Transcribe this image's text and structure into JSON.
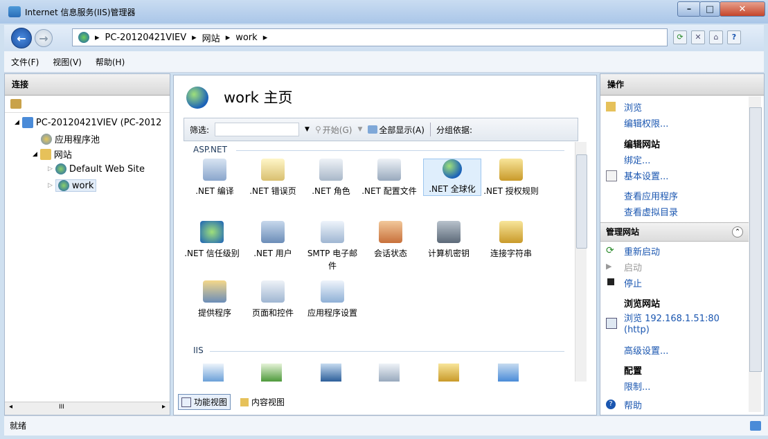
{
  "window": {
    "title": "Internet 信息服务(IIS)管理器"
  },
  "address": {
    "crumbs": [
      "PC-20120421VIEV",
      "网站",
      "work"
    ]
  },
  "menu": {
    "items": [
      "文件(F)",
      "视图(V)",
      "帮助(H)"
    ]
  },
  "left": {
    "title": "连接",
    "tree": {
      "server": "PC-20120421VIEV (PC-2012",
      "apppool": "应用程序池",
      "sites": "网站",
      "default_site": "Default Web Site",
      "work": "work"
    },
    "scroll_label": "III"
  },
  "center": {
    "title": "work 主页",
    "filter_label": "筛选:",
    "start_label": "开始(G)",
    "showall_label": "全部显示(A)",
    "groupby_label": "分组依据:",
    "section_aspnet": "ASP.NET",
    "section_iis": "IIS",
    "items": [
      {
        "label": ".NET 编译"
      },
      {
        "label": ".NET 错误页"
      },
      {
        "label": ".NET 角色"
      },
      {
        "label": ".NET 配置文件"
      },
      {
        "label": ".NET 全球化"
      },
      {
        "label": ".NET 授权规则"
      },
      {
        "label": ".NET 信任级别"
      },
      {
        "label": ".NET 用户"
      },
      {
        "label": "SMTP 电子邮件"
      },
      {
        "label": "会话状态"
      },
      {
        "label": "计算机密钥"
      },
      {
        "label": "连接字符串"
      },
      {
        "label": "提供程序"
      },
      {
        "label": "页面和控件"
      },
      {
        "label": "应用程序设置"
      }
    ],
    "tab_feature": "功能视图",
    "tab_content": "内容视图"
  },
  "right": {
    "title": "操作",
    "browse": "浏览",
    "edit_perms": "编辑权限...",
    "edit_site": "编辑网站",
    "bindings": "绑定...",
    "basic_settings": "基本设置...",
    "view_apps": "查看应用程序",
    "view_vdirs": "查看虚拟目录",
    "manage_site": "管理网站",
    "restart": "重新启动",
    "start": "启动",
    "stop": "停止",
    "browse_site": "浏览网站",
    "browse_addr": "浏览 192.168.1.51:80",
    "browse_proto": "(http)",
    "advanced": "高级设置...",
    "config": "配置",
    "limits": "限制...",
    "help": "帮助"
  },
  "status": {
    "text": "就绪"
  },
  "colors": {
    "link": "#1a56b0",
    "selection": "#dfeefc",
    "titlebar": "#c9dcf1"
  }
}
